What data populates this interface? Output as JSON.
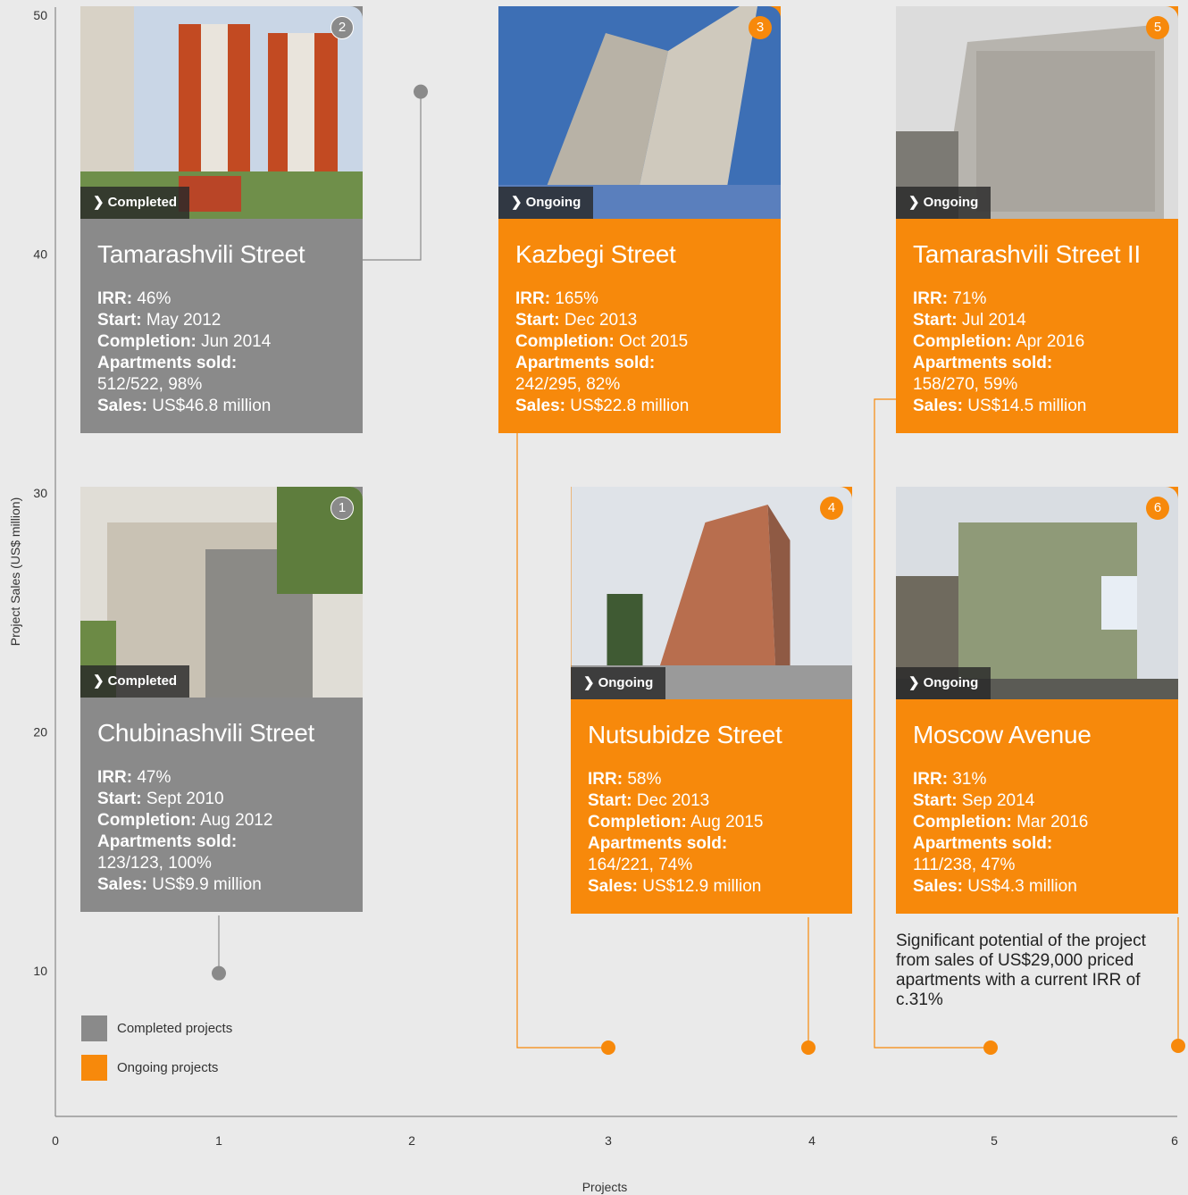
{
  "chart_data": {
    "type": "scatter",
    "xlabel": "Projects",
    "ylabel": "Project Sales (US$ million)",
    "x_ticks": [
      "0",
      "1",
      "2",
      "3",
      "4",
      "5",
      "6"
    ],
    "y_ticks": [
      "10",
      "20",
      "30",
      "40",
      "50"
    ],
    "series": [
      {
        "name": "Completed projects",
        "color": "#8a8a8a",
        "points": [
          {
            "x": 1,
            "y": 9.9
          },
          {
            "x": 2,
            "y": 46.8
          }
        ]
      },
      {
        "name": "Ongoing projects",
        "color": "#f7890b",
        "points": [
          {
            "x": 3,
            "y": 6.5
          },
          {
            "x": 4,
            "y": 6.5
          },
          {
            "x": 5,
            "y": 6.5
          },
          {
            "x": 6,
            "y": 6.6
          }
        ]
      }
    ]
  },
  "legend": {
    "completed": "Completed projects",
    "ongoing": "Ongoing projects",
    "completed_color": "#8a8a8a",
    "ongoing_color": "#f7890b"
  },
  "labels": {
    "irr": "IRR:",
    "start": "Start:",
    "completion": "Completion:",
    "apartments": "Apartments sold:",
    "sales": "Sales:"
  },
  "projects": [
    {
      "num": "1",
      "status": "Completed",
      "title": "Chubinashvili Street",
      "irr": "47%",
      "start": "Sept 2010",
      "completion": "Aug 2012",
      "apartments": "123/123, 100%",
      "sales": "US$9.9 million"
    },
    {
      "num": "2",
      "status": "Completed",
      "title": "Tamarashvili Street",
      "irr": "46%",
      "start": "May 2012",
      "completion": "Jun 2014",
      "apartments": "512/522, 98%",
      "sales": "US$46.8 million"
    },
    {
      "num": "3",
      "status": "Ongoing",
      "title": "Kazbegi Street",
      "irr": "165%",
      "start": "Dec 2013",
      "completion": "Oct 2015",
      "apartments": "242/295, 82%",
      "sales": "US$22.8 million"
    },
    {
      "num": "4",
      "status": "Ongoing",
      "title": "Nutsubidze Street",
      "irr": "58%",
      "start": "Dec 2013",
      "completion": "Aug 2015",
      "apartments": "164/221, 74%",
      "sales": "US$12.9 million"
    },
    {
      "num": "5",
      "status": "Ongoing",
      "title": "Tamarashvili Street II",
      "irr": "71%",
      "start": "Jul 2014",
      "completion": "Apr 2016",
      "apartments": "158/270, 59%",
      "sales": "US$14.5 million"
    },
    {
      "num": "6",
      "status": "Ongoing",
      "title": "Moscow Avenue",
      "irr": "31%",
      "start": "Sep 2014",
      "completion": "Mar 2016",
      "apartments": "111/238, 47%",
      "sales": "US$4.3 million"
    }
  ],
  "note": "Significant potential of the project from sales of US$29,000 priced apartments with a current IRR of c.31%"
}
